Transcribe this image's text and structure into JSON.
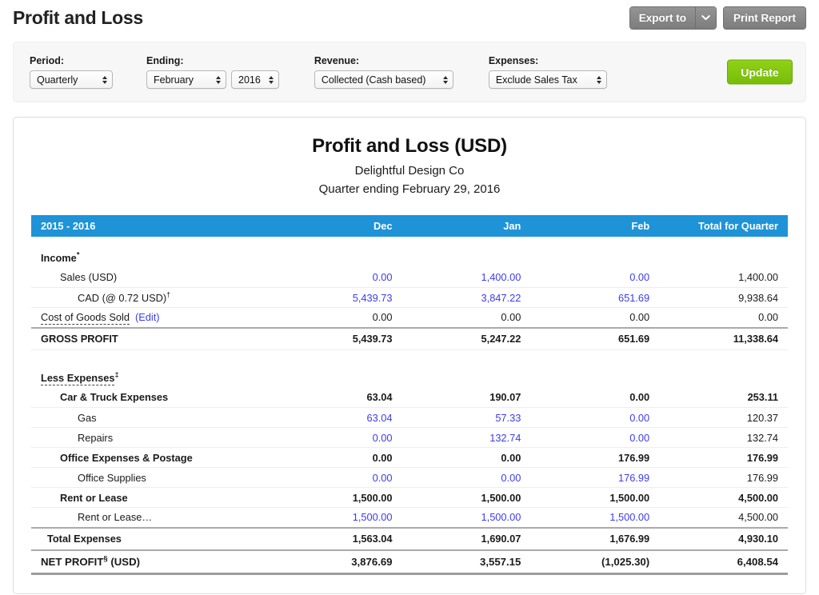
{
  "header": {
    "title": "Profit and Loss",
    "export_label": "Export to",
    "export_caret_icon": "chevron-down-icon",
    "print_label": "Print Report"
  },
  "filters": {
    "period": {
      "label": "Period:",
      "value": "Quarterly"
    },
    "ending": {
      "label": "Ending:",
      "month": "February",
      "year": "2016"
    },
    "revenue": {
      "label": "Revenue:",
      "value": "Collected (Cash based)"
    },
    "expenses": {
      "label": "Expenses:",
      "value": "Exclude Sales Tax"
    },
    "update_label": "Update"
  },
  "report": {
    "title": "Profit and Loss (USD)",
    "company": "Delightful Design Co",
    "period": "Quarter ending February 29, 2016"
  },
  "table": {
    "columns": [
      "2015 - 2016",
      "Dec",
      "Jan",
      "Feb",
      "Total for Quarter"
    ],
    "income_header": "Income",
    "income_header_mark": "*",
    "rows": {
      "sales": {
        "label": "Sales (USD)",
        "dec": "0.00",
        "jan": "1,400.00",
        "feb": "0.00",
        "total": "1,400.00"
      },
      "cad": {
        "label": "CAD (@ 0.72 USD)",
        "mark": "†",
        "dec": "5,439.73",
        "jan": "3,847.22",
        "feb": "651.69",
        "total": "9,938.64"
      },
      "cogs": {
        "label": "Cost of Goods Sold",
        "edit": "(Edit)",
        "dec": "0.00",
        "jan": "0.00",
        "feb": "0.00",
        "total": "0.00"
      },
      "gross_profit": {
        "label": "GROSS PROFIT",
        "dec": "5,439.73",
        "jan": "5,247.22",
        "feb": "651.69",
        "total": "11,338.64"
      },
      "less_expenses": {
        "label": "Less Expenses",
        "mark": "‡"
      },
      "car_truck": {
        "label": "Car & Truck Expenses",
        "dec": "63.04",
        "jan": "190.07",
        "feb": "0.00",
        "total": "253.11"
      },
      "gas": {
        "label": "Gas",
        "dec": "63.04",
        "jan": "57.33",
        "feb": "0.00",
        "total": "120.37"
      },
      "repairs": {
        "label": "Repairs",
        "dec": "0.00",
        "jan": "132.74",
        "feb": "0.00",
        "total": "132.74"
      },
      "office": {
        "label": "Office Expenses & Postage",
        "dec": "0.00",
        "jan": "0.00",
        "feb": "176.99",
        "total": "176.99"
      },
      "office_supplies": {
        "label": "Office Supplies",
        "dec": "0.00",
        "jan": "0.00",
        "feb": "176.99",
        "total": "176.99"
      },
      "rent": {
        "label": "Rent or Lease",
        "dec": "1,500.00",
        "jan": "1,500.00",
        "feb": "1,500.00",
        "total": "4,500.00"
      },
      "rent_sub": {
        "label": "Rent or Lease…",
        "dec": "1,500.00",
        "jan": "1,500.00",
        "feb": "1,500.00",
        "total": "4,500.00"
      },
      "total_expenses": {
        "label": "Total Expenses",
        "dec": "1,563.04",
        "jan": "1,690.07",
        "feb": "1,676.99",
        "total": "4,930.10"
      },
      "net_profit": {
        "label": "NET PROFIT",
        "mark": "§",
        "suffix": " (USD)",
        "dec": "3,876.69",
        "jan": "3,557.15",
        "feb": "(1,025.30)",
        "total": "6,408.54"
      }
    }
  },
  "colors": {
    "header_blue": "#1e93d8",
    "link_blue": "#3b3bf0",
    "update_green": "#7fc40e",
    "button_gray": "#858585"
  }
}
